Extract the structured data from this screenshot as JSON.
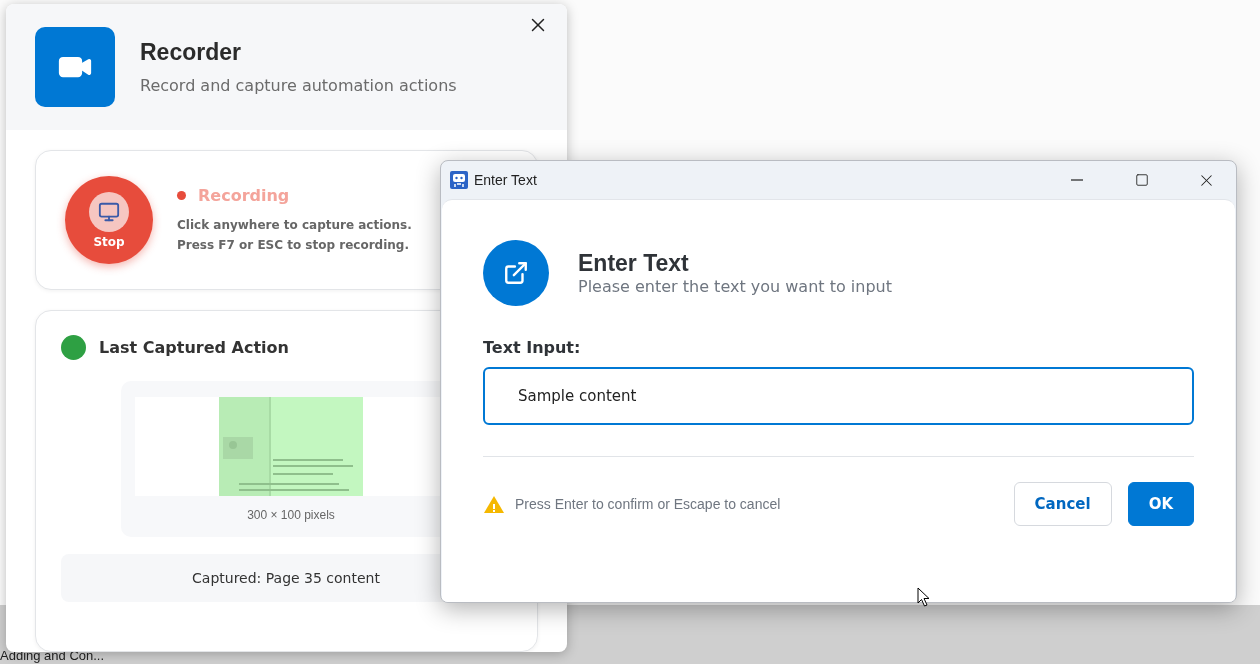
{
  "background_app": {
    "nav_item": "Adding and Con..."
  },
  "recorder": {
    "title": "Recorder",
    "subtitle": "Record and capture automation actions",
    "stop_button": "Stop",
    "status": {
      "label": "Recording",
      "recording": true
    },
    "instructions": [
      "Click anywhere to capture actions.",
      "Press F7 or ESC to stop recording."
    ],
    "last_action": {
      "title": "Last Captured Action",
      "color": "#2ea043",
      "preview_caption": "300 × 100 pixels",
      "captured_text": "Captured: Page 35 content"
    }
  },
  "dialog": {
    "window_title": "Enter Text",
    "heading": "Enter Text",
    "subheading": "Please enter the text you want to input",
    "field_label": "Text Input:",
    "input": {
      "value": "Sample content",
      "focused": true
    },
    "hint": "Press Enter to confirm or Escape to cancel",
    "buttons": [
      {
        "label": "Cancel",
        "kind": "secondary"
      },
      {
        "label": "OK",
        "kind": "primary"
      }
    ]
  }
}
